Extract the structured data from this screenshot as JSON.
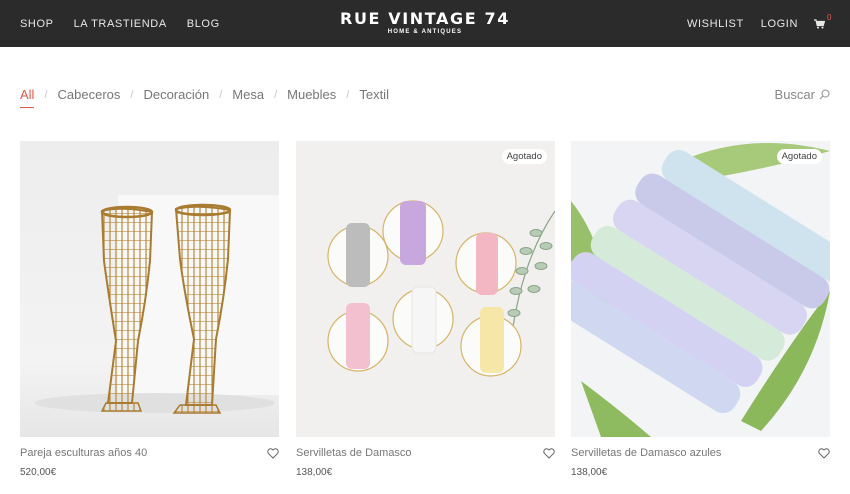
{
  "header": {
    "nav_left": [
      "SHOP",
      "LA TRASTIENDA",
      "BLOG"
    ],
    "brand_title": "RUE VINTAGE 74",
    "brand_subtitle": "HOME & ANTIQUES",
    "wishlist": "WISHLIST",
    "login": "LOGIN",
    "cart_count": "0",
    "cart_icon": "cart-icon"
  },
  "filters": {
    "items": [
      "All",
      "Cabeceros",
      "Decoración",
      "Mesa",
      "Muebles",
      "Textil"
    ],
    "separator": "/",
    "active": "All",
    "active_color": "#e05a4a"
  },
  "search": {
    "label": "Buscar",
    "icon": "search-icon"
  },
  "products": [
    {
      "name": "Pareja esculturas años 40",
      "price": "520,00€",
      "badge": ""
    },
    {
      "name": "Servilletas de Damasco",
      "price": "138,00€",
      "badge": "Agotado"
    },
    {
      "name": "Servilletas de Damasco azules",
      "price": "138,00€",
      "badge": "Agotado"
    }
  ],
  "colors": {
    "header_bg": "#2b2b2b",
    "accent": "#e05a4a"
  }
}
